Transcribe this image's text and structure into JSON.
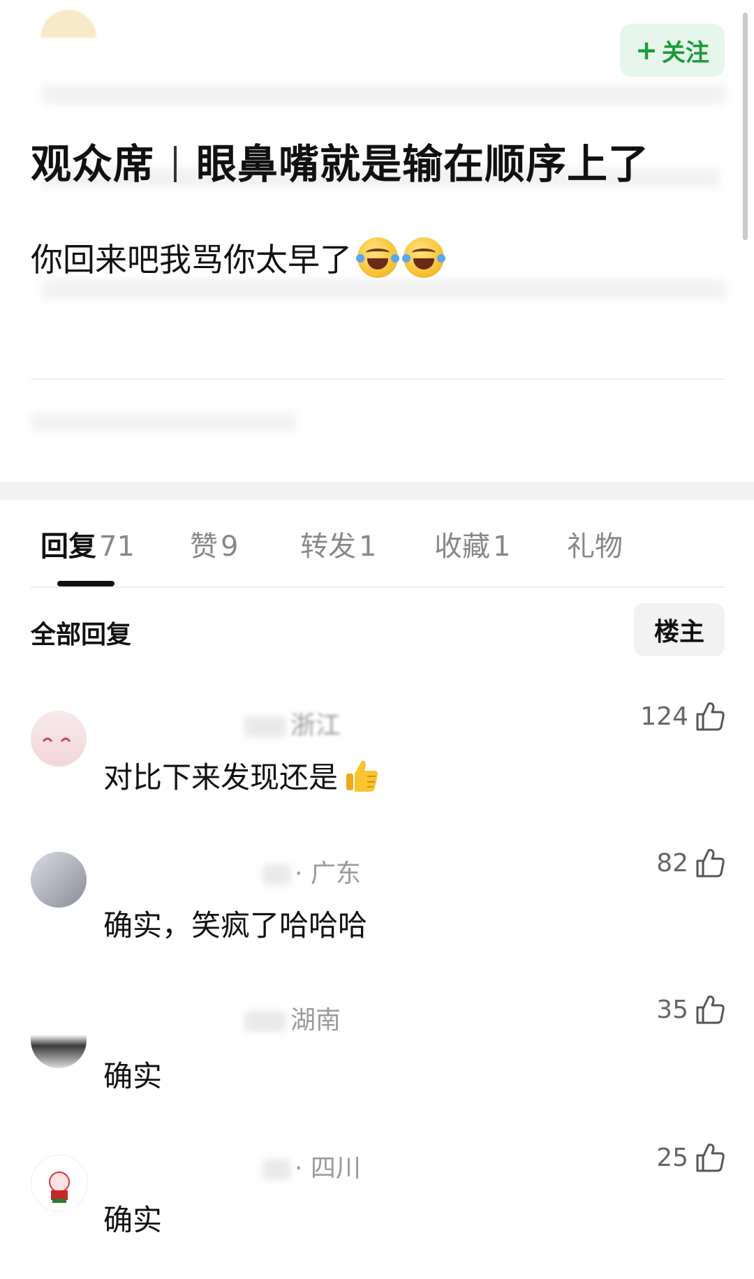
{
  "post": {
    "follow_label": "关注",
    "title_left": "观众席",
    "title_right": "眼鼻嘴就是输在顺序上了",
    "body": "你回来吧我骂你太早了"
  },
  "tabs": [
    {
      "label": "回复",
      "count": "71",
      "active": true
    },
    {
      "label": "赞",
      "count": "9",
      "active": false
    },
    {
      "label": "转发",
      "count": "1",
      "active": false
    },
    {
      "label": "收藏",
      "count": "1",
      "active": false
    },
    {
      "label": "礼物",
      "count": "",
      "active": false
    }
  ],
  "replies_header": {
    "title": "全部回复",
    "owner_button": "楼主"
  },
  "comments": [
    {
      "location": "浙江",
      "text": "对比下来发现还是",
      "likes": "124"
    },
    {
      "location": "· 广东",
      "text": "确实，笑疯了哈哈哈",
      "likes": "82"
    },
    {
      "location": "湖南",
      "text": "确实",
      "likes": "35"
    },
    {
      "location": "· 四川",
      "text": "确实",
      "likes": "25"
    }
  ],
  "colors": {
    "accent_green": "#1a9a3a",
    "follow_bg": "#e6f6ea"
  },
  "icons": [
    "plus-icon",
    "thumbs-up-outline-icon",
    "laughing-emoji-icon",
    "thumbs-up-emoji-icon"
  ]
}
